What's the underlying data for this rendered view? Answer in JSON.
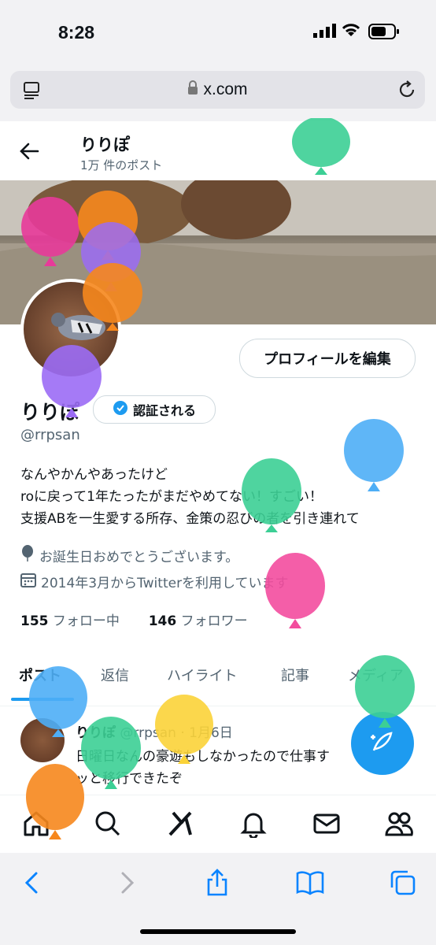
{
  "status_bar": {
    "time": "8:28"
  },
  "browser": {
    "url": "x.com"
  },
  "header": {
    "title": "りりぽ",
    "post_count": "1万 件のポスト"
  },
  "profile": {
    "edit_button": "プロフィールを編集",
    "display_name": "りりぽ",
    "verify_label": "認証される",
    "handle": "@rrpsan",
    "bio_lines": [
      "なんやかんやあったけど",
      "roに戻って1年たったがまだやめてない！すごい！",
      "支援ABを一生愛する所存、金策の忍びの者を引き連れて"
    ],
    "birthday": "お誕生日おめでとうございます。",
    "joined": "2014年3月からTwitterを利用しています",
    "following_count": "155",
    "following_label": "フォロー中",
    "followers_count": "146",
    "followers_label": "フォロワー"
  },
  "tabs": [
    {
      "label": "ポスト",
      "active": true
    },
    {
      "label": "返信"
    },
    {
      "label": "ハイライト"
    },
    {
      "label": "記事"
    },
    {
      "label": "メディア"
    }
  ],
  "post": {
    "author": "りりぽ",
    "handle_date": "@rrpsan · 1月6日",
    "lines": [
      "日曜日なんの豪遊もしなかったので仕事す",
      "ッと移行できたぞ"
    ]
  },
  "colors": {
    "accent": "#1d9bf0",
    "text": "#0f1419",
    "muted": "#536471"
  },
  "icons": [
    "back-arrow-icon",
    "verified-badge-icon",
    "balloon-icon",
    "calendar-icon",
    "compose-icon",
    "home-icon",
    "search-icon",
    "grok-icon",
    "bell-icon",
    "mail-icon",
    "people-icon",
    "safari-back-icon",
    "safari-forward-icon",
    "share-icon",
    "bookmarks-icon",
    "tabs-icon",
    "reader-icon",
    "lock-icon",
    "reload-icon"
  ]
}
